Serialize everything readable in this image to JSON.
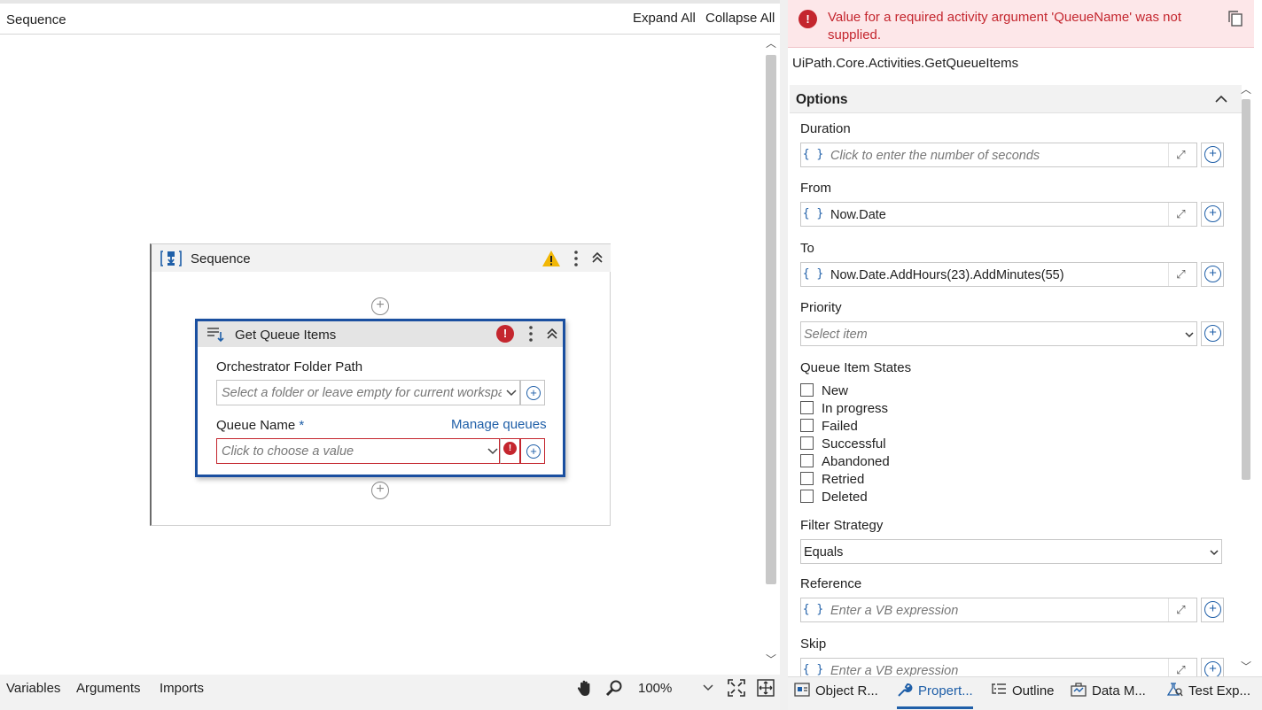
{
  "designer": {
    "breadcrumb": "Sequence",
    "expand_all": "Expand All",
    "collapse_all": "Collapse All",
    "sequence": {
      "title": "Sequence"
    },
    "activity": {
      "title": "Get Queue Items",
      "folder_label": "Orchestrator Folder Path",
      "folder_placeholder": "Select a folder or leave empty for current workspace",
      "queue_label": "Queue Name",
      "required_mark": "*",
      "manage_queues": "Manage queues",
      "queue_placeholder": "Click to choose a value"
    },
    "bottom": {
      "variables": "Variables",
      "arguments": "Arguments",
      "imports": "Imports",
      "zoom": "100%"
    }
  },
  "properties": {
    "error_message": "Value for a required activity argument 'QueueName' was not supplied.",
    "activity_type": "UiPath.Core.Activities.GetQueueItems",
    "section": "Options",
    "fields": {
      "duration": {
        "label": "Duration",
        "placeholder": "Click to enter the number of seconds"
      },
      "from": {
        "label": "From",
        "value": "Now.Date"
      },
      "to": {
        "label": "To",
        "value": "Now.Date.AddHours(23).AddMinutes(55)"
      },
      "priority": {
        "label": "Priority",
        "placeholder": "Select item"
      },
      "states": {
        "label": "Queue Item States",
        "items": [
          "New",
          "In progress",
          "Failed",
          "Successful",
          "Abandoned",
          "Retried",
          "Deleted"
        ]
      },
      "filter_strategy": {
        "label": "Filter Strategy",
        "value": "Equals"
      },
      "reference": {
        "label": "Reference",
        "placeholder": "Enter a VB expression"
      },
      "skip": {
        "label": "Skip",
        "placeholder": "Enter a VB expression"
      }
    }
  },
  "tabs": [
    {
      "label": "Object R...",
      "icon": "object-repository-icon"
    },
    {
      "label": "Propert...",
      "icon": "wrench-icon",
      "active": true
    },
    {
      "label": "Outline",
      "icon": "outline-icon"
    },
    {
      "label": "Data M...",
      "icon": "data-manager-icon"
    },
    {
      "label": "Test Exp...",
      "icon": "test-explorer-icon"
    }
  ],
  "colors": {
    "accent": "#1f5fa8",
    "error": "#c4262e",
    "error_bg": "#fde7e9",
    "warning": "#f2b705",
    "selection_border": "#1a4fa0"
  }
}
